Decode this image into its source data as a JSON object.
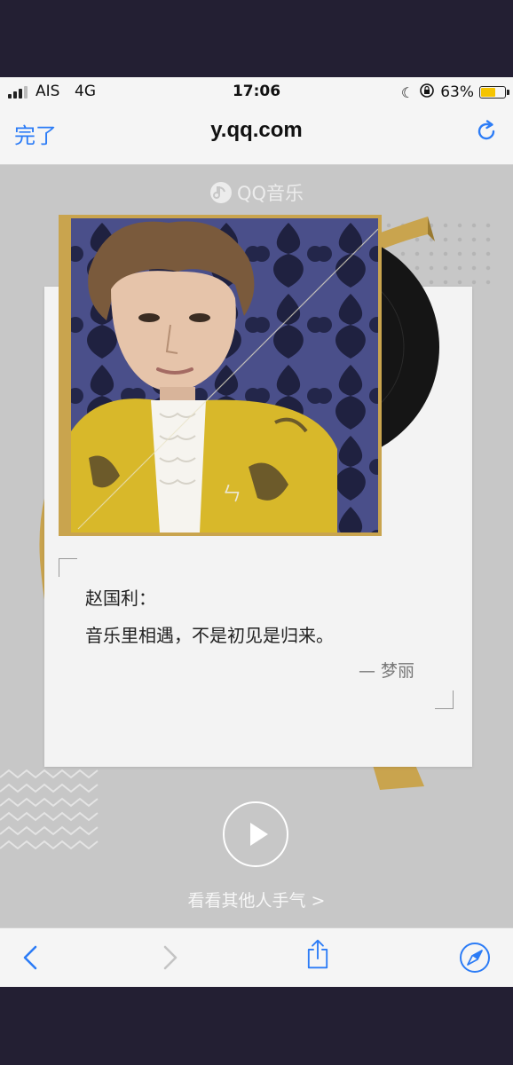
{
  "status_bar": {
    "carrier": "AIS",
    "network": "4G",
    "time": "17:06",
    "battery": "63%",
    "battery_level": 0.63,
    "icons": [
      "signal-icon",
      "moon-icon",
      "rotation-lock-icon",
      "battery-icon"
    ]
  },
  "nav": {
    "done_label": "完了",
    "url": "y.qq.com",
    "reload_icon": "reload-icon"
  },
  "page": {
    "brand": "QQ音乐",
    "quote_name": "赵国利：",
    "quote_text": "音乐里相遇，不是初见是归来。",
    "quote_author": "— 梦丽",
    "others_link": "看看其他人手气 >",
    "album_mark": "ㄣ"
  },
  "toolbar": {
    "icons": [
      "back-icon",
      "forward-icon",
      "share-icon",
      "compass-icon"
    ]
  },
  "colors": {
    "accent": "#2c7cf6",
    "gold": "#c9a44e",
    "jacket": "#d8b82a",
    "background": "#c7c7c7"
  }
}
